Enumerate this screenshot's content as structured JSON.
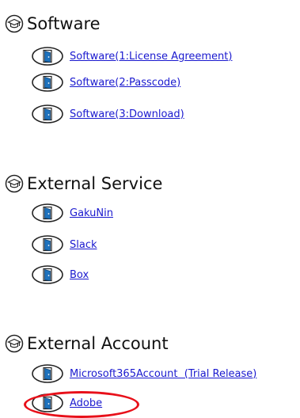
{
  "sections": [
    {
      "heading": "Software",
      "items": [
        {
          "label": "Software(1:License Agreement)"
        },
        {
          "label": "Software(2:Passcode)"
        },
        {
          "label": "Software(3:Download)"
        }
      ]
    },
    {
      "heading": "External Service",
      "items": [
        {
          "label": "GakuNin"
        },
        {
          "label": "Slack"
        },
        {
          "label": "Box"
        }
      ]
    },
    {
      "heading": "External Account",
      "items": [
        {
          "label": "Microsoft365Account  (Trial Release)"
        },
        {
          "label": "Adobe"
        }
      ]
    }
  ],
  "icons": {
    "heading": "mortarboard-icon",
    "item": "door-icon"
  },
  "colors": {
    "link": "#1a19cf",
    "highlight": "#e8101a",
    "door_fill": "#1e72bd"
  }
}
